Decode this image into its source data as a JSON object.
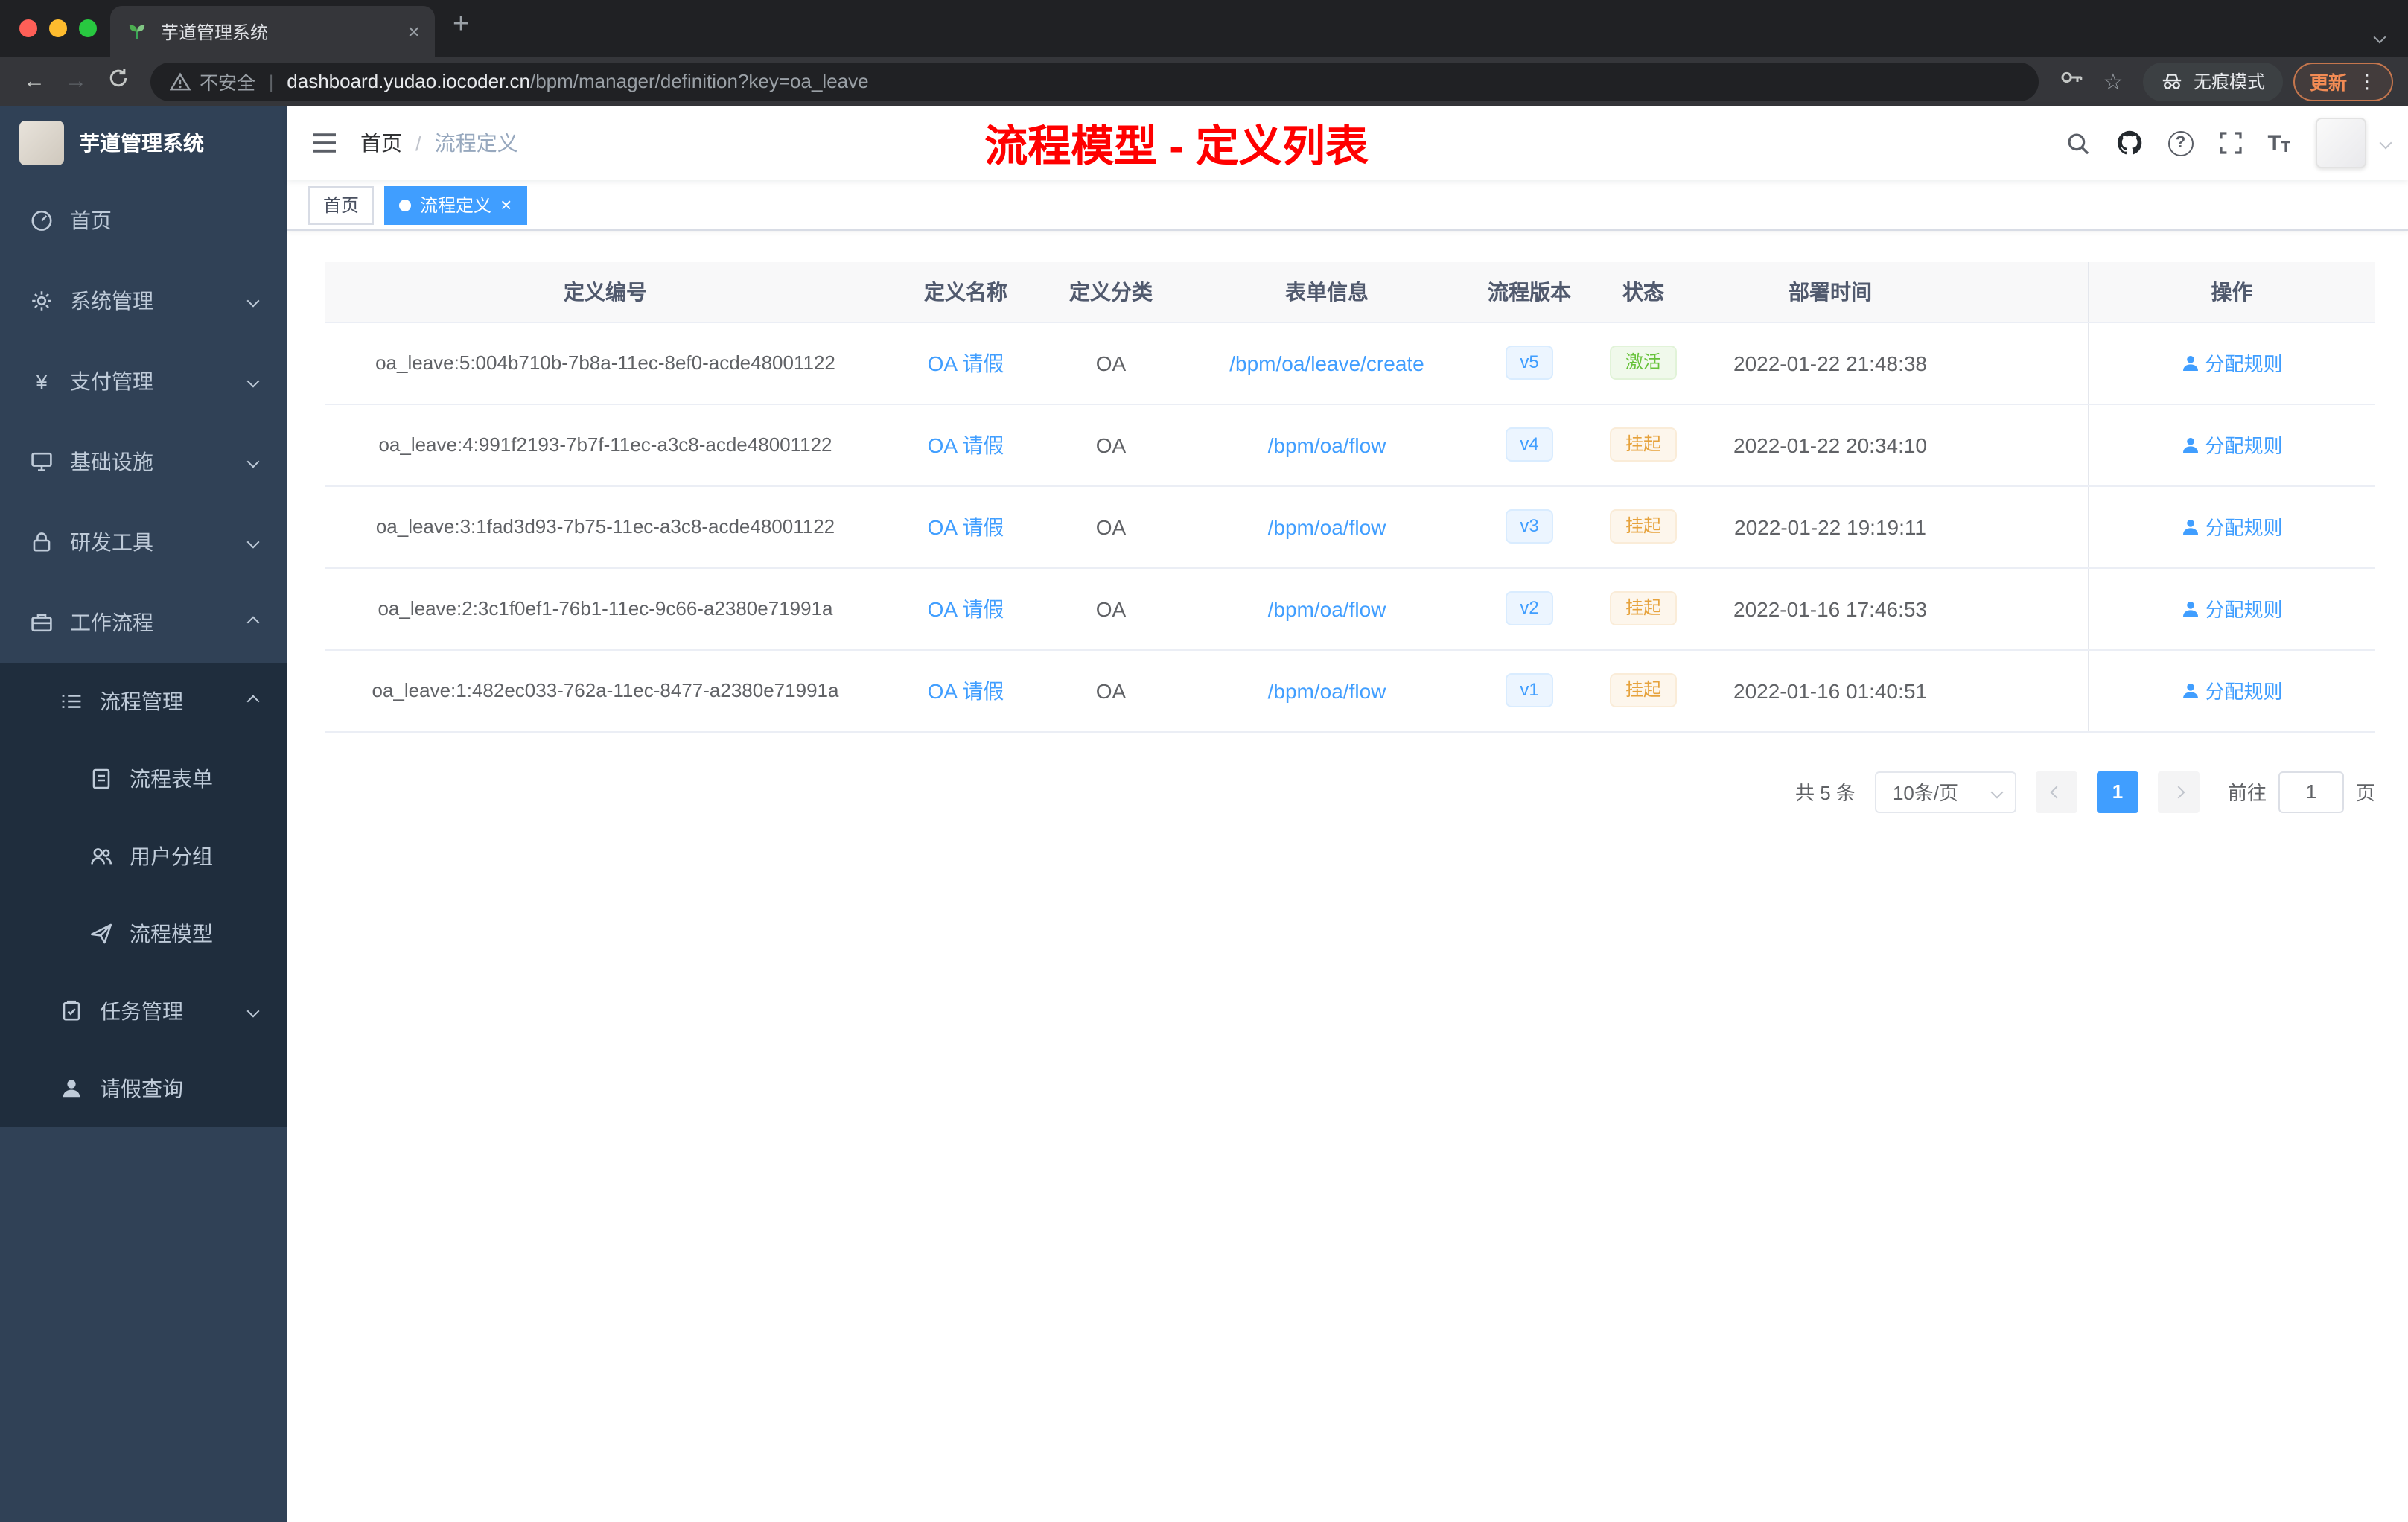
{
  "browser": {
    "tab_title": "芋道管理系统",
    "security_label": "不安全",
    "url_host": "dashboard.yudao.iocoder.cn",
    "url_path": "/bpm/manager/definition?key=oa_leave",
    "incognito_label": "无痕模式",
    "update_label": "更新"
  },
  "sidebar": {
    "title": "芋道管理系统",
    "items": [
      {
        "label": "首页",
        "icon": "dashboard-icon"
      },
      {
        "label": "系统管理",
        "icon": "gear-icon"
      },
      {
        "label": "支付管理",
        "icon": "yen-icon"
      },
      {
        "label": "基础设施",
        "icon": "monitor-icon"
      },
      {
        "label": "研发工具",
        "icon": "lock-icon"
      },
      {
        "label": "工作流程",
        "icon": "briefcase-icon"
      },
      {
        "label": "流程管理",
        "icon": "list-icon"
      },
      {
        "label": "流程表单",
        "icon": "document-icon"
      },
      {
        "label": "用户分组",
        "icon": "users-icon"
      },
      {
        "label": "流程模型",
        "icon": "paper-plane-icon"
      },
      {
        "label": "任务管理",
        "icon": "clipboard-icon"
      },
      {
        "label": "请假查询",
        "icon": "user-icon"
      }
    ]
  },
  "navbar": {
    "breadcrumb_home": "首页",
    "breadcrumb_separator": "/",
    "breadcrumb_current": "流程定义",
    "banner": "流程模型 - 定义列表",
    "icons": [
      "search-icon",
      "github-icon",
      "help-icon",
      "fullscreen-icon",
      "font-size-icon",
      "avatar",
      "caret-down-icon"
    ]
  },
  "tags": {
    "home": "首页",
    "active": "流程定义"
  },
  "table": {
    "headers": [
      "定义编号",
      "定义名称",
      "定义分类",
      "表单信息",
      "流程版本",
      "状态",
      "部署时间",
      "操作"
    ],
    "rows": [
      {
        "id": "oa_leave:5:004b710b-7b8a-11ec-8ef0-acde48001122",
        "name": "OA 请假",
        "category": "OA",
        "form": "/bpm/oa/leave/create",
        "version": "v5",
        "status": "激活",
        "time": "2022-01-22 21:48:38",
        "action": "分配规则"
      },
      {
        "id": "oa_leave:4:991f2193-7b7f-11ec-a3c8-acde48001122",
        "name": "OA 请假",
        "category": "OA",
        "form": "/bpm/oa/flow",
        "version": "v4",
        "status": "挂起",
        "time": "2022-01-22 20:34:10",
        "action": "分配规则"
      },
      {
        "id": "oa_leave:3:1fad3d93-7b75-11ec-a3c8-acde48001122",
        "name": "OA 请假",
        "category": "OA",
        "form": "/bpm/oa/flow",
        "version": "v3",
        "status": "挂起",
        "time": "2022-01-22 19:19:11",
        "action": "分配规则"
      },
      {
        "id": "oa_leave:2:3c1f0ef1-76b1-11ec-9c66-a2380e71991a",
        "name": "OA 请假",
        "category": "OA",
        "form": "/bpm/oa/flow",
        "version": "v2",
        "status": "挂起",
        "time": "2022-01-16 17:46:53",
        "action": "分配规则"
      },
      {
        "id": "oa_leave:1:482ec033-762a-11ec-8477-a2380e71991a",
        "name": "OA 请假",
        "category": "OA",
        "form": "/bpm/oa/flow",
        "version": "v1",
        "status": "挂起",
        "time": "2022-01-16 01:40:51",
        "action": "分配规则"
      }
    ]
  },
  "pagination": {
    "total": "共 5 条",
    "page_size": "10条/页",
    "page": "1",
    "goto_label": "前往",
    "goto_value": "1",
    "goto_unit": "页"
  },
  "colors": {
    "accent": "#409eff",
    "banner_red": "#ff0000",
    "status_active": "#67c23a",
    "status_suspended": "#e6a23c",
    "sidebar_bg": "#304156",
    "submenu_bg": "#1f2d3d"
  }
}
